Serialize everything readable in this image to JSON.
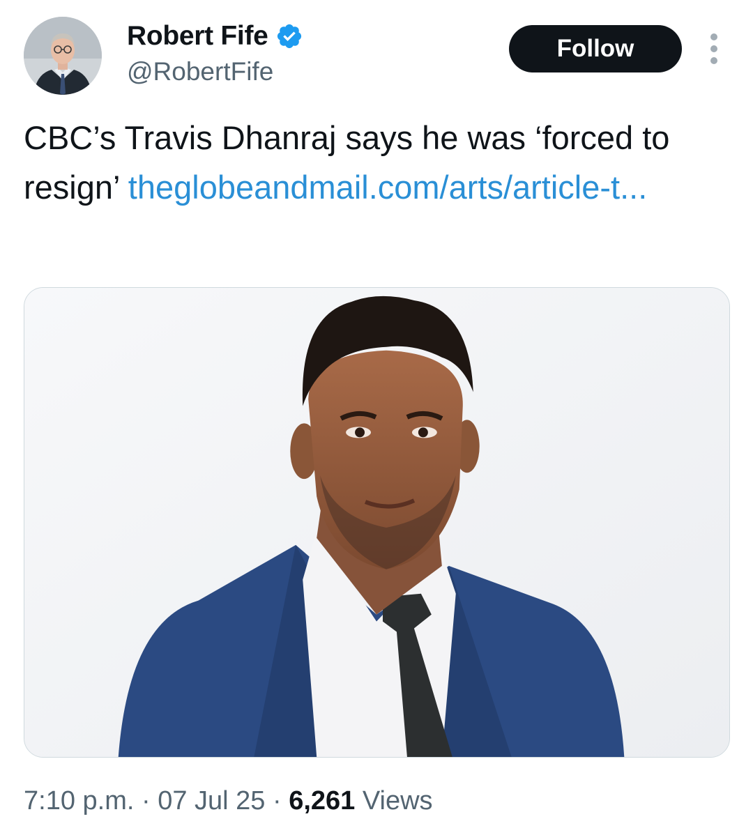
{
  "author": {
    "name": "Robert Fife",
    "handle": "@RobertFife",
    "verified": true
  },
  "follow_label": "Follow",
  "tweet": {
    "text": "CBC’s Travis Dhanraj says he was ‘forced to resign’ ",
    "link_text": "theglobeandmail.com/arts/article-t..."
  },
  "meta": {
    "time": "7:10 p.m.",
    "separator": " · ",
    "date": "07 Jul 25",
    "views_count": "6,261",
    "views_label": " Views"
  },
  "colors": {
    "link": "#2a8fd6",
    "verified": "#1d9bf0",
    "follow_bg": "#0f1419",
    "secondary_text": "#536471"
  },
  "icons": {
    "verified": "verified-badge-icon",
    "more": "more-options-icon"
  }
}
